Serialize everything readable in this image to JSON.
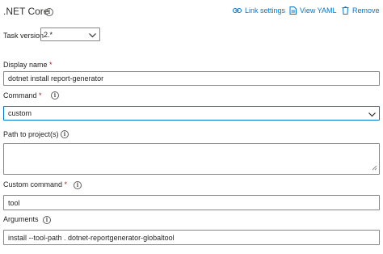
{
  "header": {
    "title": ".NET Core",
    "link_settings": "Link settings",
    "view_yaml": "View YAML",
    "remove": "Remove"
  },
  "task_version": {
    "label": "Task version",
    "value": "2.*"
  },
  "display_name": {
    "label": "Display name",
    "required_mark": "*",
    "value": "dotnet install report-generator"
  },
  "command": {
    "label": "Command",
    "required_mark": "*",
    "value": "custom"
  },
  "path_to_projects": {
    "label": "Path to project(s)",
    "value": ""
  },
  "custom_command": {
    "label": "Custom command",
    "required_mark": "*",
    "value": "tool"
  },
  "arguments": {
    "label": "Arguments",
    "value": "install --tool-path . dotnet-reportgenerator-globaltool"
  },
  "colors": {
    "accent": "#0078d4",
    "required": "#a4262c",
    "border": "#8a8886"
  },
  "icons": [
    "info-icon",
    "link-icon",
    "yaml-icon",
    "trash-icon",
    "chevron-down-icon",
    "resize-handle-icon"
  ]
}
